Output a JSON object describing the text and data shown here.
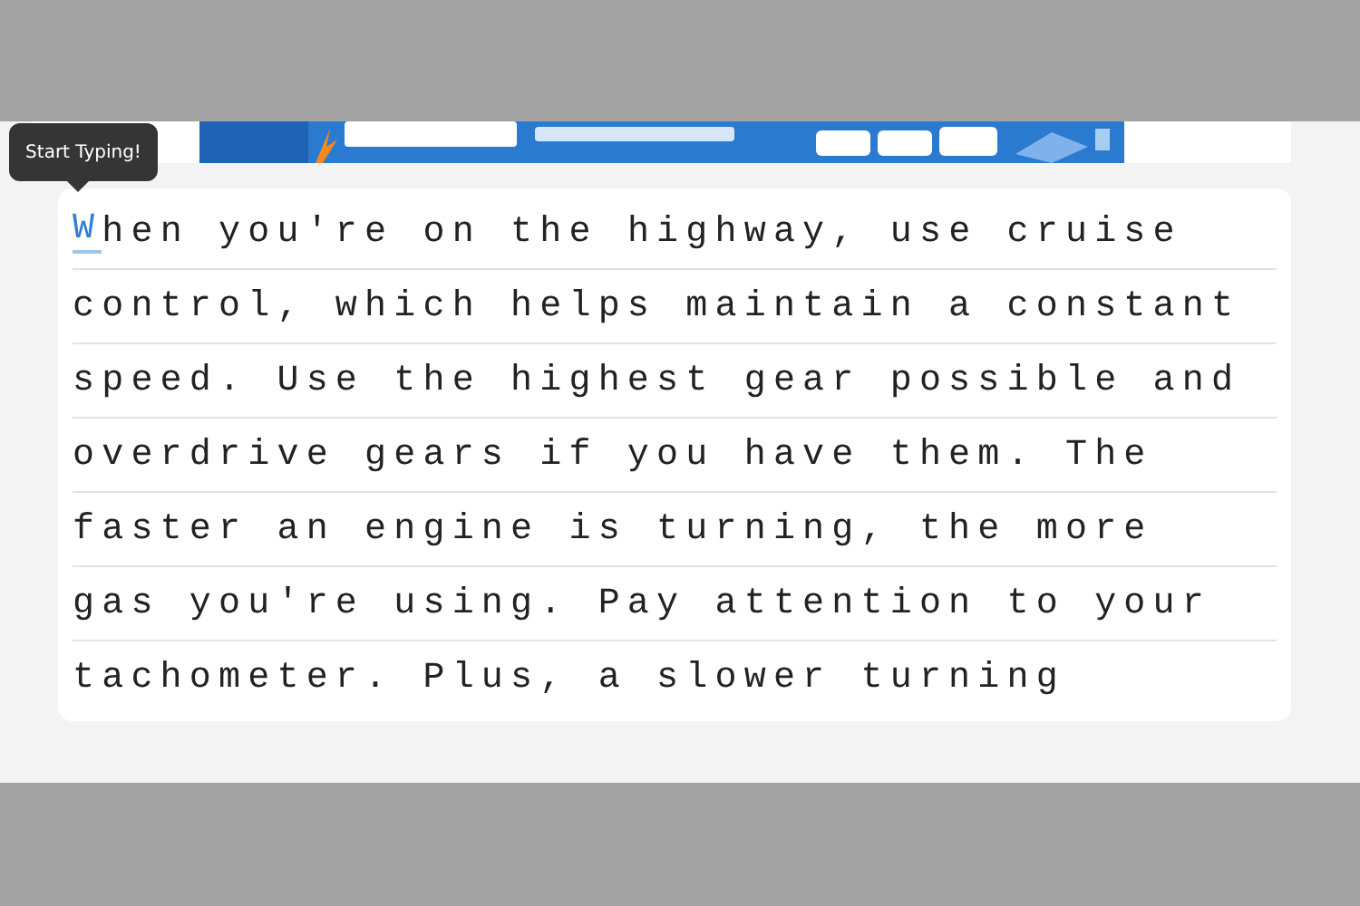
{
  "tooltip": {
    "text": "Start Typing!"
  },
  "passage": {
    "lines": [
      {
        "current": "W",
        "text": "hen you're on the highway, use cruise"
      },
      {
        "text": "control, which helps maintain a constant"
      },
      {
        "text": "speed. Use the highest gear possible and"
      },
      {
        "text": "overdrive gears if you have them. The"
      },
      {
        "text": "faster an engine is turning, the more"
      },
      {
        "text": "gas you're using. Pay attention to your"
      },
      {
        "text": "tachometer. Plus, a slower turning"
      }
    ]
  }
}
